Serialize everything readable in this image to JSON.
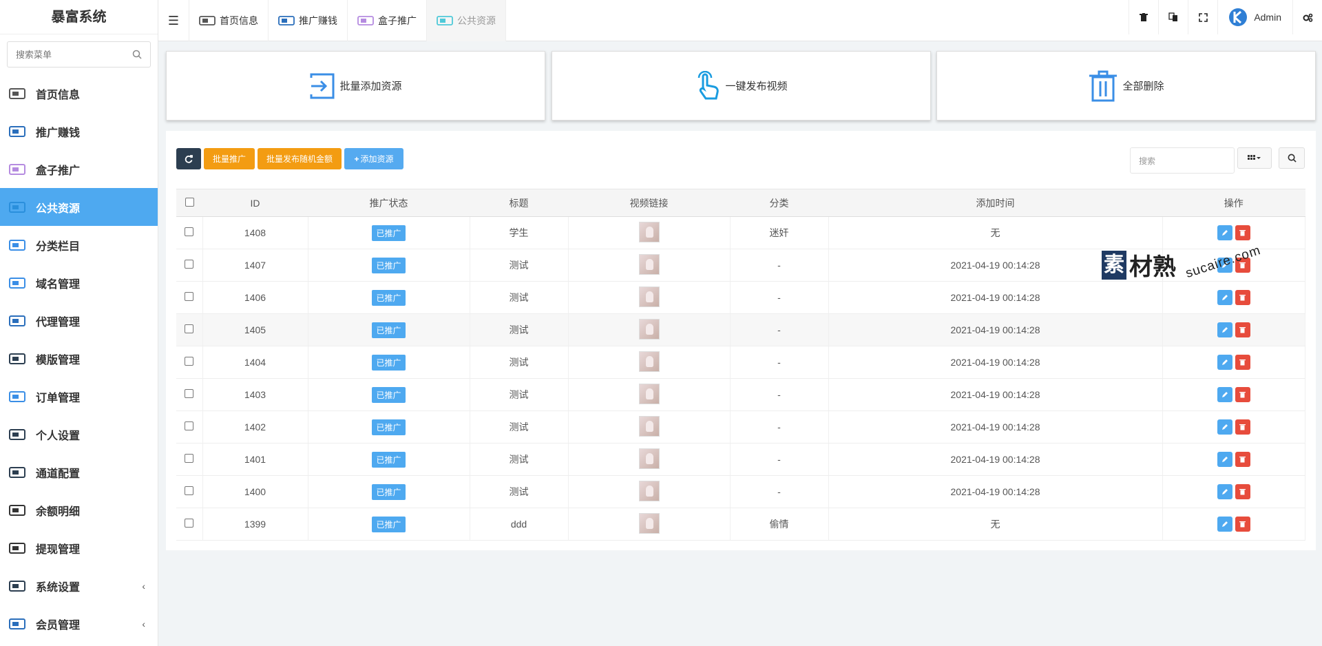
{
  "app": {
    "title": "暴富系统"
  },
  "sidebar": {
    "search_placeholder": "搜索菜单",
    "items": [
      {
        "label": "首页信息",
        "icon": "home-info-icon",
        "active": false
      },
      {
        "label": "推广赚钱",
        "icon": "promote-icon",
        "active": false
      },
      {
        "label": "盒子推广",
        "icon": "box-icon",
        "active": false
      },
      {
        "label": "公共资源",
        "icon": "public-resource-icon",
        "active": true
      },
      {
        "label": "分类栏目",
        "icon": "category-icon",
        "active": false
      },
      {
        "label": "域名管理",
        "icon": "domain-icon",
        "active": false
      },
      {
        "label": "代理管理",
        "icon": "agent-icon",
        "active": false
      },
      {
        "label": "模版管理",
        "icon": "template-icon",
        "active": false
      },
      {
        "label": "订单管理",
        "icon": "order-icon",
        "active": false
      },
      {
        "label": "个人设置",
        "icon": "personal-settings-icon",
        "active": false
      },
      {
        "label": "通道配置",
        "icon": "channel-icon",
        "active": false
      },
      {
        "label": "余额明细",
        "icon": "balance-icon",
        "active": false
      },
      {
        "label": "提现管理",
        "icon": "withdraw-icon",
        "active": false
      },
      {
        "label": "系统设置",
        "icon": "system-settings-icon",
        "active": false,
        "arrow": "‹"
      },
      {
        "label": "会员管理",
        "icon": "member-icon",
        "active": false,
        "arrow": "‹"
      }
    ]
  },
  "topbar": {
    "tabs": [
      {
        "label": "首页信息",
        "active": false
      },
      {
        "label": "推广赚钱",
        "active": false
      },
      {
        "label": "盒子推广",
        "active": false
      },
      {
        "label": "公共资源",
        "active": true
      }
    ],
    "user": "Admin"
  },
  "cards": [
    {
      "label": "批量添加资源",
      "icon": "import-icon"
    },
    {
      "label": "一键发布视频",
      "icon": "hand-pointer-icon"
    },
    {
      "label": "全部删除",
      "icon": "trash-icon"
    }
  ],
  "toolbar": {
    "batch_promote": "批量推广",
    "batch_random": "批量发布随机金额",
    "add_resource": "添加资源",
    "search_placeholder": "搜索"
  },
  "table": {
    "columns": [
      "ID",
      "推广状态",
      "标题",
      "视频链接",
      "分类",
      "添加时间",
      "操作"
    ],
    "rows": [
      {
        "id": "1408",
        "status": "已推广",
        "title": "学生",
        "category": "迷奸",
        "time": "无"
      },
      {
        "id": "1407",
        "status": "已推广",
        "title": "测试",
        "category": "-",
        "time": "2021-04-19 00:14:28"
      },
      {
        "id": "1406",
        "status": "已推广",
        "title": "测试",
        "category": "-",
        "time": "2021-04-19 00:14:28"
      },
      {
        "id": "1405",
        "status": "已推广",
        "title": "测试",
        "category": "-",
        "time": "2021-04-19 00:14:28"
      },
      {
        "id": "1404",
        "status": "已推广",
        "title": "测试",
        "category": "-",
        "time": "2021-04-19 00:14:28"
      },
      {
        "id": "1403",
        "status": "已推广",
        "title": "测试",
        "category": "-",
        "time": "2021-04-19 00:14:28"
      },
      {
        "id": "1402",
        "status": "已推广",
        "title": "测试",
        "category": "-",
        "time": "2021-04-19 00:14:28"
      },
      {
        "id": "1401",
        "status": "已推广",
        "title": "测试",
        "category": "-",
        "time": "2021-04-19 00:14:28"
      },
      {
        "id": "1400",
        "status": "已推广",
        "title": "测试",
        "category": "-",
        "time": "2021-04-19 00:14:28"
      },
      {
        "id": "1399",
        "status": "已推广",
        "title": "ddd",
        "category": "偷情",
        "time": "无"
      }
    ]
  },
  "watermark": {
    "boxed": "素",
    "text": "材熟",
    "domain": "sucaire.com"
  },
  "colors": {
    "accent": "#4ea9f0",
    "dark": "#2c3e50",
    "orange": "#f39c12",
    "danger": "#e74c3c"
  }
}
